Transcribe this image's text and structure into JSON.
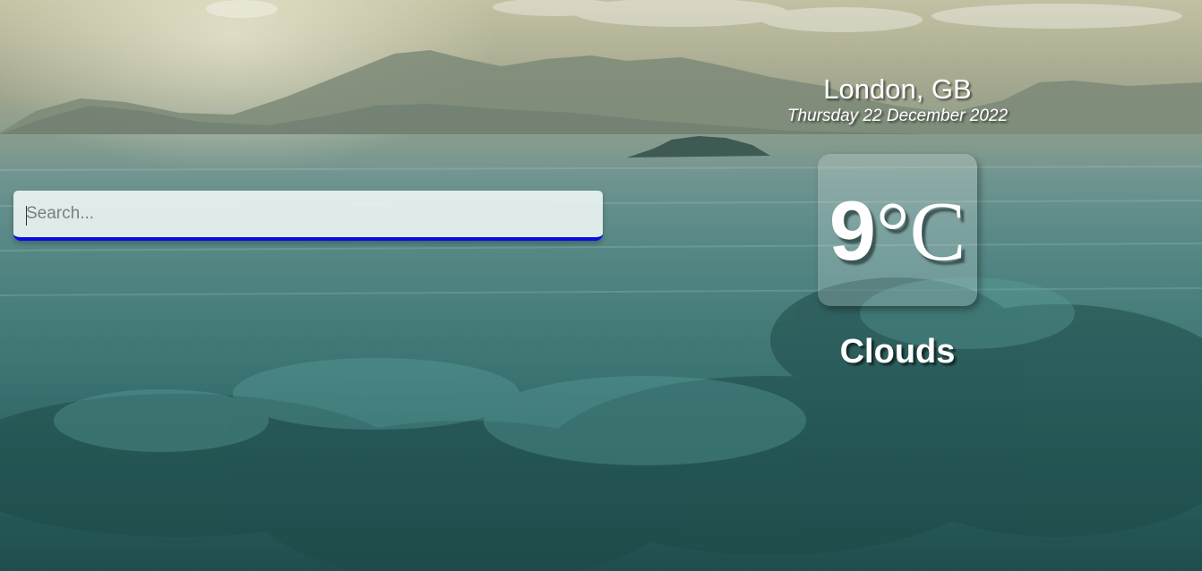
{
  "search": {
    "placeholder": "Search..."
  },
  "weather": {
    "location": "London, GB",
    "date": "Thursday 22 December 2022",
    "temperature_value": "9",
    "temperature_unit": "°C",
    "condition": "Clouds"
  },
  "colors": {
    "search_underline": "#0a0ae6",
    "text": "#ffffff"
  }
}
